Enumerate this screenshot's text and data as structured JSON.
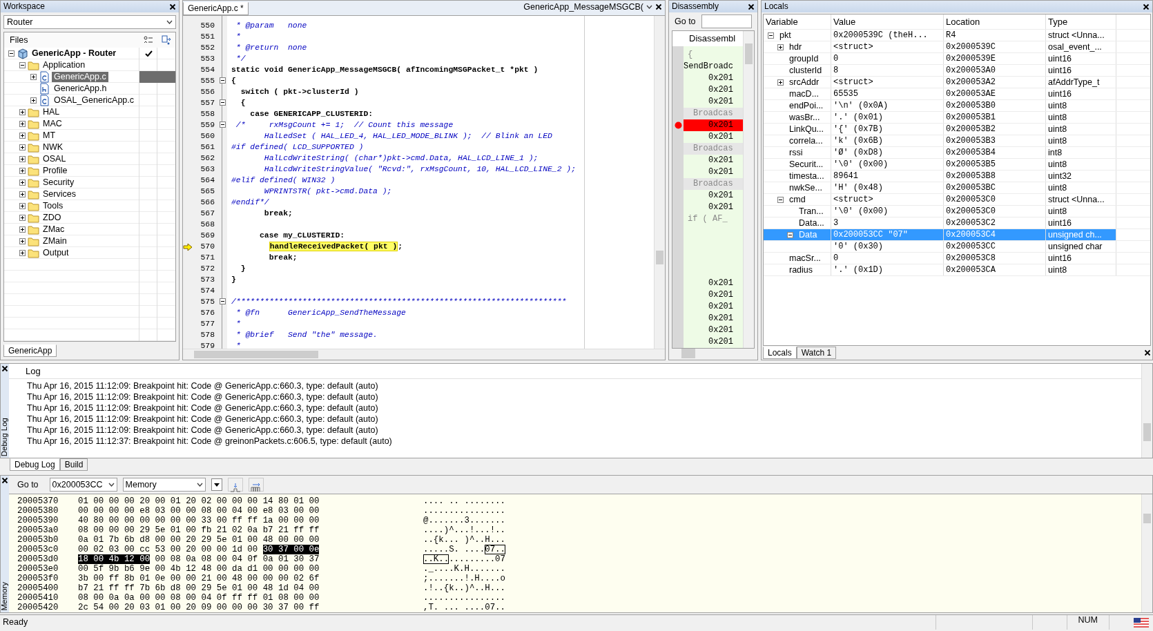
{
  "workspace": {
    "title": "Workspace",
    "configuration": "Router",
    "files_header": "Files",
    "tree": [
      {
        "label": "GenericApp - Router",
        "kind": "project",
        "expanded": true,
        "selected": false,
        "checked": true,
        "children": [
          {
            "label": "Application",
            "kind": "folder",
            "expanded": true,
            "selected": false,
            "children": [
              {
                "label": "GenericApp.c",
                "kind": "c-file",
                "expanded": false,
                "selected": true
              },
              {
                "label": "GenericApp.h",
                "kind": "h-file",
                "selected": false
              },
              {
                "label": "OSAL_GenericApp.c",
                "kind": "c-file",
                "expanded": false,
                "selected": false
              }
            ]
          },
          {
            "label": "HAL",
            "kind": "folder",
            "expanded": false,
            "selected": false
          },
          {
            "label": "MAC",
            "kind": "folder",
            "expanded": false,
            "selected": false
          },
          {
            "label": "MT",
            "kind": "folder",
            "expanded": false,
            "selected": false
          },
          {
            "label": "NWK",
            "kind": "folder",
            "expanded": false,
            "selected": false
          },
          {
            "label": "OSAL",
            "kind": "folder",
            "expanded": false,
            "selected": false
          },
          {
            "label": "Profile",
            "kind": "folder",
            "expanded": false,
            "selected": false
          },
          {
            "label": "Security",
            "kind": "folder",
            "expanded": false,
            "selected": false
          },
          {
            "label": "Services",
            "kind": "folder",
            "expanded": false,
            "selected": false
          },
          {
            "label": "Tools",
            "kind": "folder",
            "expanded": false,
            "selected": false
          },
          {
            "label": "ZDO",
            "kind": "folder",
            "expanded": false,
            "selected": false
          },
          {
            "label": "ZMac",
            "kind": "folder",
            "expanded": false,
            "selected": false
          },
          {
            "label": "ZMain",
            "kind": "folder",
            "expanded": false,
            "selected": false
          },
          {
            "label": "Output",
            "kind": "folder",
            "expanded": false,
            "selected": false
          }
        ]
      }
    ],
    "tabs": [
      {
        "label": "GenericApp",
        "selected": true
      }
    ]
  },
  "editor": {
    "tabs": [
      {
        "label": "GenericApp.c *",
        "selected": true
      }
    ],
    "function": "GenericApp_MessageMSGCB(",
    "lines": [
      {
        "number": "550",
        "kind": "comment",
        "collapsible": false,
        "current": false,
        "text": " * @param   none"
      },
      {
        "number": "551",
        "kind": "comment",
        "collapsible": false,
        "current": false,
        "text": " *"
      },
      {
        "number": "552",
        "kind": "comment",
        "collapsible": false,
        "current": false,
        "text": " * @return  none"
      },
      {
        "number": "553",
        "kind": "comment",
        "collapsible": false,
        "current": false,
        "text": " */"
      },
      {
        "number": "554",
        "kind": "code",
        "collapsible": false,
        "current": false,
        "text": "static void GenericApp_MessageMSGCB( afIncomingMSGPacket_t *pkt )"
      },
      {
        "number": "555",
        "kind": "code",
        "collapsible": true,
        "current": false,
        "text": "{"
      },
      {
        "number": "556",
        "kind": "code",
        "collapsible": false,
        "current": false,
        "text": "  switch ( pkt->clusterId )"
      },
      {
        "number": "557",
        "kind": "code",
        "collapsible": true,
        "current": false,
        "text": "  {"
      },
      {
        "number": "558",
        "kind": "code",
        "collapsible": false,
        "current": false,
        "text": "    case GENERICAPP_CLUSTERID:"
      },
      {
        "number": "559",
        "kind": "comment",
        "collapsible": true,
        "current": false,
        "text": " /*     rxMsgCount += 1;  // Count this message"
      },
      {
        "number": "560",
        "kind": "comment",
        "collapsible": false,
        "current": false,
        "text": "       HalLedSet ( HAL_LED_4, HAL_LED_MODE_BLINK );  // Blink an LED"
      },
      {
        "number": "561",
        "kind": "comment",
        "collapsible": false,
        "current": false,
        "text": "#if defined( LCD_SUPPORTED )"
      },
      {
        "number": "562",
        "kind": "comment",
        "collapsible": false,
        "current": false,
        "text": "       HalLcdWriteString( (char*)pkt->cmd.Data, HAL_LCD_LINE_1 );"
      },
      {
        "number": "563",
        "kind": "comment",
        "collapsible": false,
        "current": false,
        "text": "       HalLcdWriteStringValue( \"Rcvd:\", rxMsgCount, 10, HAL_LCD_LINE_2 );"
      },
      {
        "number": "564",
        "kind": "comment",
        "collapsible": false,
        "current": false,
        "text": "#elif defined( WIN32 )"
      },
      {
        "number": "565",
        "kind": "comment",
        "collapsible": false,
        "current": false,
        "text": "       WPRINTSTR( pkt->cmd.Data );"
      },
      {
        "number": "566",
        "kind": "comment",
        "collapsible": false,
        "current": false,
        "text": "#endif*/"
      },
      {
        "number": "567",
        "kind": "code",
        "collapsible": false,
        "current": false,
        "text": "       break;"
      },
      {
        "number": "568",
        "kind": "code",
        "collapsible": false,
        "current": false
      },
      {
        "number": "569",
        "kind": "code",
        "collapsible": false,
        "current": false,
        "text": "      case my_CLUSTERID:"
      },
      {
        "number": "570",
        "kind": "code",
        "collapsible": false,
        "current": true,
        "highlight": "handleReceivedPacket( pkt )",
        "after": ";"
      },
      {
        "number": "571",
        "kind": "code",
        "collapsible": false,
        "current": false,
        "text": "        break;"
      },
      {
        "number": "572",
        "kind": "code",
        "collapsible": false,
        "current": false,
        "text": "  }"
      },
      {
        "number": "573",
        "kind": "code",
        "collapsible": false,
        "current": false,
        "text": "}"
      },
      {
        "number": "574",
        "kind": "code",
        "collapsible": false,
        "current": false
      },
      {
        "number": "575",
        "kind": "comment",
        "collapsible": true,
        "current": false,
        "text": "/**********************************************************************"
      },
      {
        "number": "576",
        "kind": "comment",
        "collapsible": false,
        "current": false,
        "text": " * @fn      GenericApp_SendTheMessage"
      },
      {
        "number": "577",
        "kind": "comment",
        "collapsible": false,
        "current": false,
        "text": " *"
      },
      {
        "number": "578",
        "kind": "comment",
        "collapsible": false,
        "current": false,
        "text": " * @brief   Send \"the\" message."
      },
      {
        "number": "579",
        "kind": "comment",
        "collapsible": false,
        "current": false,
        "text": " *"
      }
    ]
  },
  "disassembly": {
    "title": "Disassembly",
    "goto_label": "Go to",
    "header": "Disassembl",
    "lines": [
      {
        "kind": "source",
        "text": "{"
      },
      {
        "kind": "label",
        "text": "SendBroadc"
      },
      {
        "kind": "instruction",
        "text": "0x201"
      },
      {
        "kind": "instruction",
        "text": "0x201"
      },
      {
        "kind": "instruction",
        "text": "0x201"
      },
      {
        "kind": "separator",
        "text": "Broadcas"
      },
      {
        "kind": "breakpoint",
        "text": "0x201"
      },
      {
        "kind": "instruction",
        "text": "0x201"
      },
      {
        "kind": "separator",
        "text": "Broadcas"
      },
      {
        "kind": "instruction",
        "text": "0x201"
      },
      {
        "kind": "instruction",
        "text": "0x201"
      },
      {
        "kind": "separator",
        "text": "Broadcas"
      },
      {
        "kind": "instruction",
        "text": "0x201"
      },
      {
        "kind": "instruction",
        "text": "0x201"
      },
      {
        "kind": "source",
        "text": "if ( AF_"
      }
    ],
    "tail_lines": [
      {
        "kind": "instruction",
        "text": "0x201"
      },
      {
        "kind": "instruction",
        "text": "0x201"
      },
      {
        "kind": "instruction",
        "text": "0x201"
      },
      {
        "kind": "instruction",
        "text": "0x201"
      },
      {
        "kind": "instruction",
        "text": "0x201"
      },
      {
        "kind": "instruction",
        "text": "0x201"
      }
    ]
  },
  "locals": {
    "title": "Locals",
    "columns": [
      "Variable",
      "Value",
      "Location",
      "Type"
    ],
    "rows": [
      {
        "variable": "pkt",
        "value": "0x2000539C (theH...",
        "location": "R4",
        "type": "struct <Unna...",
        "expanded": true,
        "selected": false,
        "children": [
          {
            "variable": "hdr",
            "value": "<struct>",
            "location": "0x2000539C",
            "type": "osal_event_...",
            "expanded": false,
            "selected": false
          },
          {
            "variable": "groupId",
            "value": "0",
            "location": "0x2000539E",
            "type": "uint16",
            "selected": false
          },
          {
            "variable": "clusterId",
            "value": "8",
            "location": "0x200053A0",
            "type": "uint16",
            "selected": false
          },
          {
            "variable": "srcAddr",
            "value": "<struct>",
            "location": "0x200053A2",
            "type": "afAddrType_t",
            "expanded": false,
            "selected": false
          },
          {
            "variable": "macD...",
            "value": "65535",
            "location": "0x200053AE",
            "type": "uint16",
            "selected": false
          },
          {
            "variable": "endPoi...",
            "value": "'\\n' (0x0A)",
            "location": "0x200053B0",
            "type": "uint8",
            "selected": false
          },
          {
            "variable": "wasBr...",
            "value": "'.' (0x01)",
            "location": "0x200053B1",
            "type": "uint8",
            "selected": false
          },
          {
            "variable": "LinkQu...",
            "value": "'{' (0x7B)",
            "location": "0x200053B2",
            "type": "uint8",
            "selected": false
          },
          {
            "variable": "correla...",
            "value": "'k' (0x6B)",
            "location": "0x200053B3",
            "type": "uint8",
            "selected": false
          },
          {
            "variable": "rssi",
            "value": "'Ø' (0xD8)",
            "location": "0x200053B4",
            "type": "int8",
            "selected": false
          },
          {
            "variable": "Securit...",
            "value": "'\\0' (0x00)",
            "location": "0x200053B5",
            "type": "uint8",
            "selected": false
          },
          {
            "variable": "timesta...",
            "value": "89641",
            "location": "0x200053B8",
            "type": "uint32",
            "selected": false
          },
          {
            "variable": "nwkSe...",
            "value": "'H' (0x48)",
            "location": "0x200053BC",
            "type": "uint8",
            "selected": false
          },
          {
            "variable": "cmd",
            "value": "<struct>",
            "location": "0x200053C0",
            "type": "struct <Unna...",
            "expanded": true,
            "selected": false,
            "children": [
              {
                "variable": "Tran...",
                "value": "'\\0' (0x00)",
                "location": "0x200053C0",
                "type": "uint8",
                "selected": false
              },
              {
                "variable": "Data...",
                "value": "3",
                "location": "0x200053C2",
                "type": "uint16",
                "selected": false
              },
              {
                "variable": "Data",
                "value": "0x200053CC \"07\"",
                "location": "0x200053C4",
                "type": "unsigned ch...",
                "expanded": true,
                "selected": true,
                "children": [
                  {
                    "value": "'0' (0x30)",
                    "location": "0x200053CC",
                    "type": "unsigned char",
                    "selected": false
                  }
                ]
              }
            ]
          },
          {
            "variable": "macSr...",
            "value": "0",
            "location": "0x200053C8",
            "type": "uint16",
            "selected": false
          },
          {
            "variable": "radius",
            "value": "'.' (0x1D)",
            "location": "0x200053CA",
            "type": "uint8",
            "selected": false
          }
        ]
      }
    ],
    "tabs": [
      {
        "label": "Locals",
        "selected": true
      },
      {
        "label": "Watch 1",
        "selected": false
      }
    ]
  },
  "log": {
    "side_label": "Debug Log",
    "header": "Log",
    "lines": [
      "Thu Apr 16, 2015 11:12:09: Breakpoint hit: Code @ GenericApp.c:660.3, type: default (auto)",
      "Thu Apr 16, 2015 11:12:09: Breakpoint hit: Code @ GenericApp.c:660.3, type: default (auto)",
      "Thu Apr 16, 2015 11:12:09: Breakpoint hit: Code @ GenericApp.c:660.3, type: default (auto)",
      "Thu Apr 16, 2015 11:12:09: Breakpoint hit: Code @ GenericApp.c:660.3, type: default (auto)",
      "Thu Apr 16, 2015 11:12:09: Breakpoint hit: Code @ GenericApp.c:660.3, type: default (auto)",
      "Thu Apr 16, 2015 11:12:37: Breakpoint hit: Code @ greinonPackets.c:606.5, type: default (auto)"
    ],
    "tabs": [
      {
        "label": "Debug Log",
        "selected": true
      },
      {
        "label": "Build",
        "selected": false
      }
    ]
  },
  "memory": {
    "side_label": "Memory",
    "goto_label": "Go to",
    "goto_value": "0x200053CC",
    "zone": "Memory",
    "rows": [
      {
        "address": "20005370",
        "hex": [
          {
            "text": "01 00 00 00 20 00 01 20 02 00 00 00 14 80 01 00",
            "selected": false
          }
        ],
        "ascii": [
          {
            "text": ".... .. ........",
            "selected": false
          }
        ]
      },
      {
        "address": "20005380",
        "hex": [
          {
            "text": "00 00 00 00 e8 03 00 00 08 00 04 00 e8 03 00 00",
            "selected": false
          }
        ],
        "ascii": [
          {
            "text": "................",
            "selected": false
          }
        ]
      },
      {
        "address": "20005390",
        "hex": [
          {
            "text": "40 80 00 00 00 00 00 00 33 00 ff ff 1a 00 00 00",
            "selected": false
          }
        ],
        "ascii": [
          {
            "text": "@.......3.......",
            "selected": false
          }
        ]
      },
      {
        "address": "200053a0",
        "hex": [
          {
            "text": "08 00 00 00 29 5e 01 00 fb 21 02 0a b7 21 ff ff",
            "selected": false
          }
        ],
        "ascii": [
          {
            "text": "....)^...!...!..",
            "selected": false
          }
        ]
      },
      {
        "address": "200053b0",
        "hex": [
          {
            "text": "0a 01 7b 6b d8 00 00 20 29 5e 01 00 48 00 00 00",
            "selected": false
          }
        ],
        "ascii": [
          {
            "text": "..{k... )^..H...",
            "selected": false
          }
        ]
      },
      {
        "address": "200053c0",
        "hex": [
          {
            "text": "00 02 03 00 cc 53 00 20 00 00 1d 00 ",
            "selected": false
          },
          {
            "text": "30 37 00 0e",
            "selected": true
          }
        ],
        "ascii": [
          {
            "text": ".....S. ....",
            "selected": false
          },
          {
            "text": "07..",
            "selected": true
          }
        ]
      },
      {
        "address": "200053d0",
        "hex": [
          {
            "text": "18 00 4b 12 00",
            "selected": true
          },
          {
            "text": " 00 08 0a 08 00 04 0f 0a 01 30 37",
            "selected": false
          }
        ],
        "ascii": [
          {
            "text": "..K..",
            "selected": true
          },
          {
            "text": ".........07",
            "selected": false
          }
        ]
      },
      {
        "address": "200053e0",
        "hex": [
          {
            "text": "00 5f 9b b6 9e 00 4b 12 48 00 da d1 00 00 00 00",
            "selected": false
          }
        ],
        "ascii": [
          {
            "text": "._....K.H.......",
            "selected": false
          }
        ]
      },
      {
        "address": "200053f0",
        "hex": [
          {
            "text": "3b 00 ff 8b 01 0e 00 00 21 00 48 00 00 00 02 6f",
            "selected": false
          }
        ],
        "ascii": [
          {
            "text": ";.......!.H....o",
            "selected": false
          }
        ]
      },
      {
        "address": "20005400",
        "hex": [
          {
            "text": "b7 21 ff ff 7b 6b d8 00 29 5e 01 00 48 1d 04 00",
            "selected": false
          }
        ],
        "ascii": [
          {
            "text": ".!..{k..)^..H...",
            "selected": false
          }
        ]
      },
      {
        "address": "20005410",
        "hex": [
          {
            "text": "08 00 0a 0a 00 00 08 00 04 0f ff ff 01 08 00 00",
            "selected": false
          }
        ],
        "ascii": [
          {
            "text": "................",
            "selected": false
          }
        ]
      },
      {
        "address": "20005420",
        "hex": [
          {
            "text": "2c 54 00 20 03 01 00 20 09 00 00 00 30 37 00 ff",
            "selected": false
          }
        ],
        "ascii": [
          {
            "text": ",T. ... ....07..",
            "selected": false
          }
        ]
      }
    ]
  },
  "status_bar": {
    "message": "Ready",
    "indicator": "NUM"
  }
}
